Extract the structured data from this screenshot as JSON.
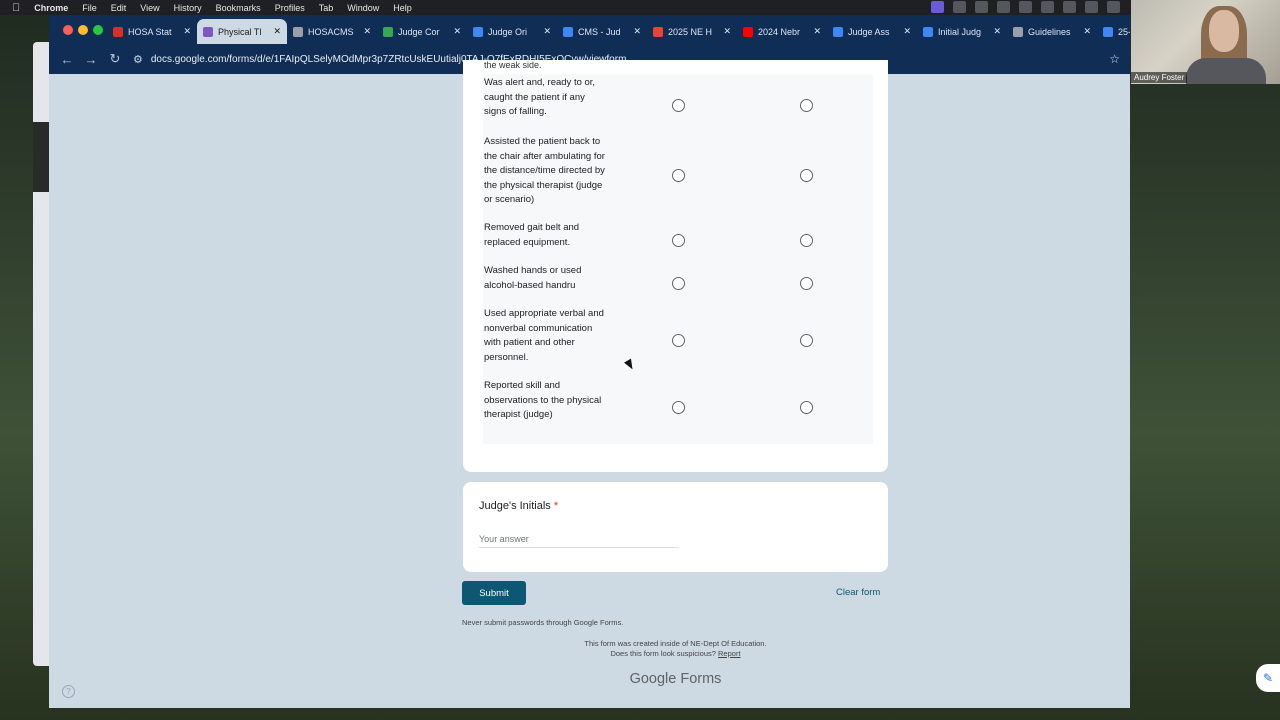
{
  "menubar": {
    "app": "Chrome",
    "items": [
      "File",
      "Edit",
      "View",
      "History",
      "Bookmarks",
      "Profiles",
      "Tab",
      "Window",
      "Help"
    ]
  },
  "tabs": [
    {
      "label": "HOSA Stat",
      "color": "#d93025"
    },
    {
      "label": "Physical Tl",
      "color": "#7e57c2"
    },
    {
      "label": "HOSACMS",
      "color": "#9aa0a6"
    },
    {
      "label": "Judge Cor",
      "color": "#34a853"
    },
    {
      "label": "Judge Ori",
      "color": "#4285f4"
    },
    {
      "label": "CMS - Jud",
      "color": "#4285f4"
    },
    {
      "label": "2025 NE H",
      "color": "#ea4335"
    },
    {
      "label": "2024 Nebr",
      "color": "#ff0000"
    },
    {
      "label": "Judge Ass",
      "color": "#4285f4"
    },
    {
      "label": "Initial Judg",
      "color": "#4285f4"
    },
    {
      "label": "Guidelines",
      "color": "#9aa0a6"
    },
    {
      "label": "25-",
      "color": "#4285f4"
    }
  ],
  "url": "docs.google.com/forms/d/e/1FAIpQLSelyMOdMpr3p7ZRtcUskEUutialj0TAJ-O7fExRDHI5ExQCyw/viewform",
  "form": {
    "prev_item_fragment": "the weak side.",
    "items": [
      {
        "label": "Was alert and, ready to or, caught the patient if any signs of falling."
      },
      {
        "label": "Assisted the patient back to the chair after ambulating for the distance/time directed by the physical therapist (judge or scenario)"
      },
      {
        "label": "Removed gait belt and replaced equipment."
      },
      {
        "label": "Washed hands or used alcohol-based handru"
      },
      {
        "label": "Used appropriate verbal and nonverbal communication with patient and other personnel."
      },
      {
        "label": "Reported skill and observations to the physical therapist (judge)"
      }
    ],
    "initials": {
      "question": "Judge's Initials",
      "required_mark": "*",
      "placeholder": "Your answer"
    },
    "submit_label": "Submit",
    "clear_label": "Clear form",
    "never_submit": "Never submit passwords through Google Forms.",
    "created_text": "This form was created inside of NE-Dept Of Education.",
    "suspicious_text": "Does this form look suspicious?",
    "report_label": "Report",
    "brand": "Google Forms"
  },
  "webcam": {
    "name": "Audrey Foster"
  }
}
